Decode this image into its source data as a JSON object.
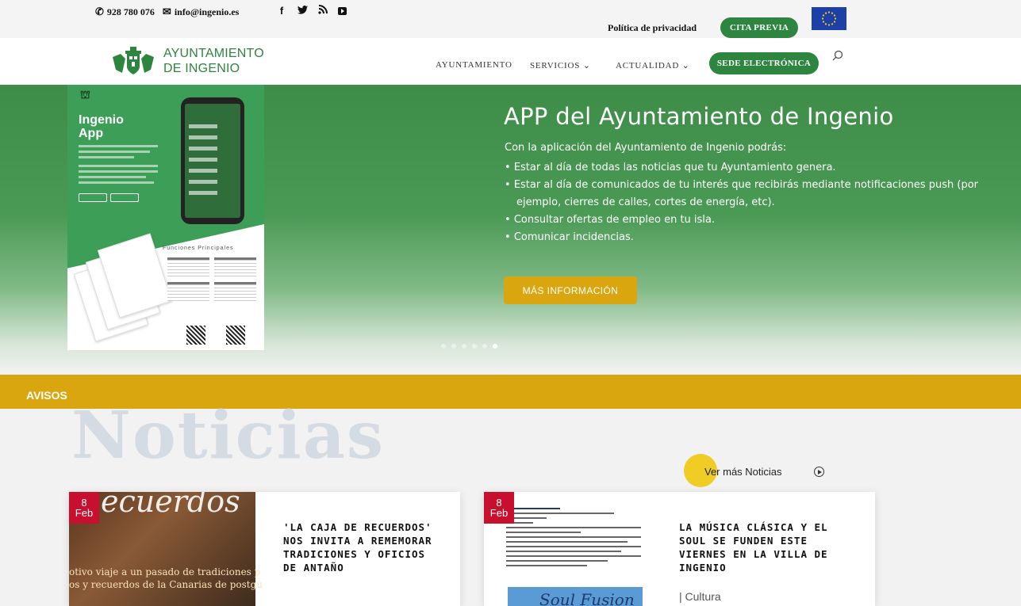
{
  "topbar": {
    "phone": "928 780 076",
    "email": "info@ingenio.es",
    "social_icons": [
      "facebook-icon",
      "twitter-icon",
      "rss-icon",
      "youtube-icon"
    ],
    "privacy_link": "Política de privacidad",
    "cita_button": "CITA PREVIA"
  },
  "header": {
    "logo_line1": "AYUNTAMIENTO",
    "logo_line2": "DE INGENIO",
    "nav": [
      {
        "label": "AYUNTAMIENTO"
      },
      {
        "label": "SERVICIOS ⌄"
      },
      {
        "label": "ACTUALIDAD ⌄"
      }
    ],
    "sede_button": "SEDE ELECTRÓNICA"
  },
  "hero": {
    "poster": {
      "title_line1": "Ingenio",
      "title_line2": "App",
      "subtitle": "Funciones Principales"
    },
    "title": "APP del Ayuntamiento de Ingenio",
    "intro": "Con la aplicación del Ayuntamiento de Ingenio podrás:",
    "items": [
      "Estar al día de todas las noticias que tu Ayuntamiento genera.",
      "Estar al día de comunicados de tu interés que recibirás mediante notificaciones push (por ejemplo, cierres de calles, cortes de energía, etc).",
      "Consultar ofertas de empleo en tu isla.",
      "Comunicar incidencias."
    ],
    "button": "MÁS INFORMACIÓN",
    "slides_total": 6,
    "active_slide": 6
  },
  "avisos": {
    "label": "AVISOS"
  },
  "noticias": {
    "heading": "Noticias",
    "more_link": "Ver más Noticias",
    "items": [
      {
        "day": "8",
        "month": "Feb",
        "image_word": "ecuerdos",
        "image_caption_1": "otivo viaje a un pasado de tradiciones p",
        "image_caption_2": "os y recuerdos de la Canarias de postgu",
        "title": "'LA CAJA DE RECUERDOS' NOS INVITA A REMEMORAR TRADICIONES Y OFICIOS DE ANTAÑO"
      },
      {
        "day": "8",
        "month": "Feb",
        "image_word": "Soul Fusion",
        "title": "LA MÚSICA CLÁSICA Y EL SOUL SE FUNDEN ESTE VIERNES EN LA VILLA DE INGENIO",
        "category": "| Cultura"
      }
    ]
  },
  "colors": {
    "green": "#2e8540",
    "gold": "#d9a60f",
    "red_badge": "#c8102e",
    "eu_blue": "#1d3fa8"
  }
}
